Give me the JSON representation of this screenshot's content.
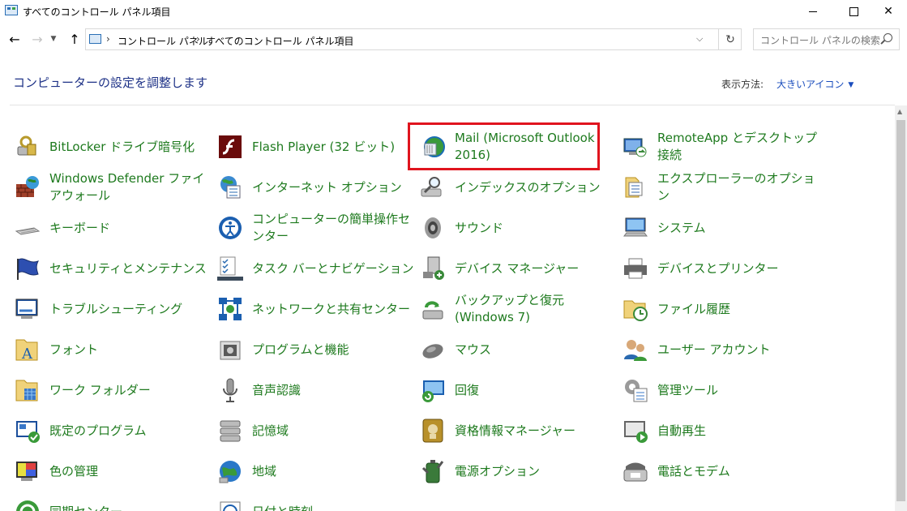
{
  "window": {
    "title": "すべてのコントロール パネル項目"
  },
  "address": {
    "crumbs": [
      "コントロール パネル",
      "すべてのコントロール パネル項目"
    ]
  },
  "search": {
    "placeholder": "コントロール パネルの検索"
  },
  "header": {
    "heading": "コンピューターの設定を調整します",
    "view_by_label": "表示方法:",
    "view_by_value": "大きいアイコン"
  },
  "colors": {
    "link_green": "#1e7a1e",
    "heading_blue": "#1e3287",
    "highlight_red": "#e0141e"
  },
  "items": [
    {
      "label": "BitLocker ドライブ暗号化",
      "icon": "bitlocker-icon"
    },
    {
      "label": "Flash Player (32 ビット)",
      "icon": "flash-player-icon"
    },
    {
      "label": "Mail (Microsoft Outlook 2016)",
      "icon": "mail-icon"
    },
    {
      "label": "RemoteApp とデスクトップ接続",
      "icon": "remoteapp-icon"
    },
    {
      "label": "Windows Defender ファイアウォール",
      "icon": "firewall-icon"
    },
    {
      "label": "インターネット オプション",
      "icon": "internet-options-icon"
    },
    {
      "label": "インデックスのオプション",
      "icon": "indexing-icon"
    },
    {
      "label": "エクスプローラーのオプション",
      "icon": "explorer-options-icon"
    },
    {
      "label": "キーボード",
      "icon": "keyboard-icon"
    },
    {
      "label": "コンピューターの簡単操作センター",
      "icon": "ease-of-access-icon"
    },
    {
      "label": "サウンド",
      "icon": "sound-icon"
    },
    {
      "label": "システム",
      "icon": "system-icon"
    },
    {
      "label": "セキュリティとメンテナンス",
      "icon": "security-flag-icon"
    },
    {
      "label": "タスク バーとナビゲーション",
      "icon": "taskbar-icon"
    },
    {
      "label": "デバイス マネージャー",
      "icon": "device-manager-icon"
    },
    {
      "label": "デバイスとプリンター",
      "icon": "printer-icon"
    },
    {
      "label": "トラブルシューティング",
      "icon": "troubleshooting-icon"
    },
    {
      "label": "ネットワークと共有センター",
      "icon": "network-icon"
    },
    {
      "label": "バックアップと復元 (Windows 7)",
      "icon": "backup-icon"
    },
    {
      "label": "ファイル履歴",
      "icon": "file-history-icon"
    },
    {
      "label": "フォント",
      "icon": "font-folder-icon"
    },
    {
      "label": "プログラムと機能",
      "icon": "programs-icon"
    },
    {
      "label": "マウス",
      "icon": "mouse-icon"
    },
    {
      "label": "ユーザー アカウント",
      "icon": "users-icon"
    },
    {
      "label": "ワーク フォルダー",
      "icon": "work-folders-icon"
    },
    {
      "label": "音声認識",
      "icon": "microphone-icon"
    },
    {
      "label": "回復",
      "icon": "recovery-icon"
    },
    {
      "label": "管理ツール",
      "icon": "admin-tools-icon"
    },
    {
      "label": "既定のプログラム",
      "icon": "default-programs-icon"
    },
    {
      "label": "記憶域",
      "icon": "storage-icon"
    },
    {
      "label": "資格情報マネージャー",
      "icon": "credential-icon"
    },
    {
      "label": "自動再生",
      "icon": "autoplay-icon"
    },
    {
      "label": "色の管理",
      "icon": "color-management-icon"
    },
    {
      "label": "地域",
      "icon": "region-globe-icon"
    },
    {
      "label": "電源オプション",
      "icon": "power-icon"
    },
    {
      "label": "電話とモデム",
      "icon": "phone-icon"
    },
    {
      "label": "同期センター",
      "icon": "sync-icon"
    },
    {
      "label": "日付と時刻",
      "icon": "clock-icon"
    }
  ]
}
